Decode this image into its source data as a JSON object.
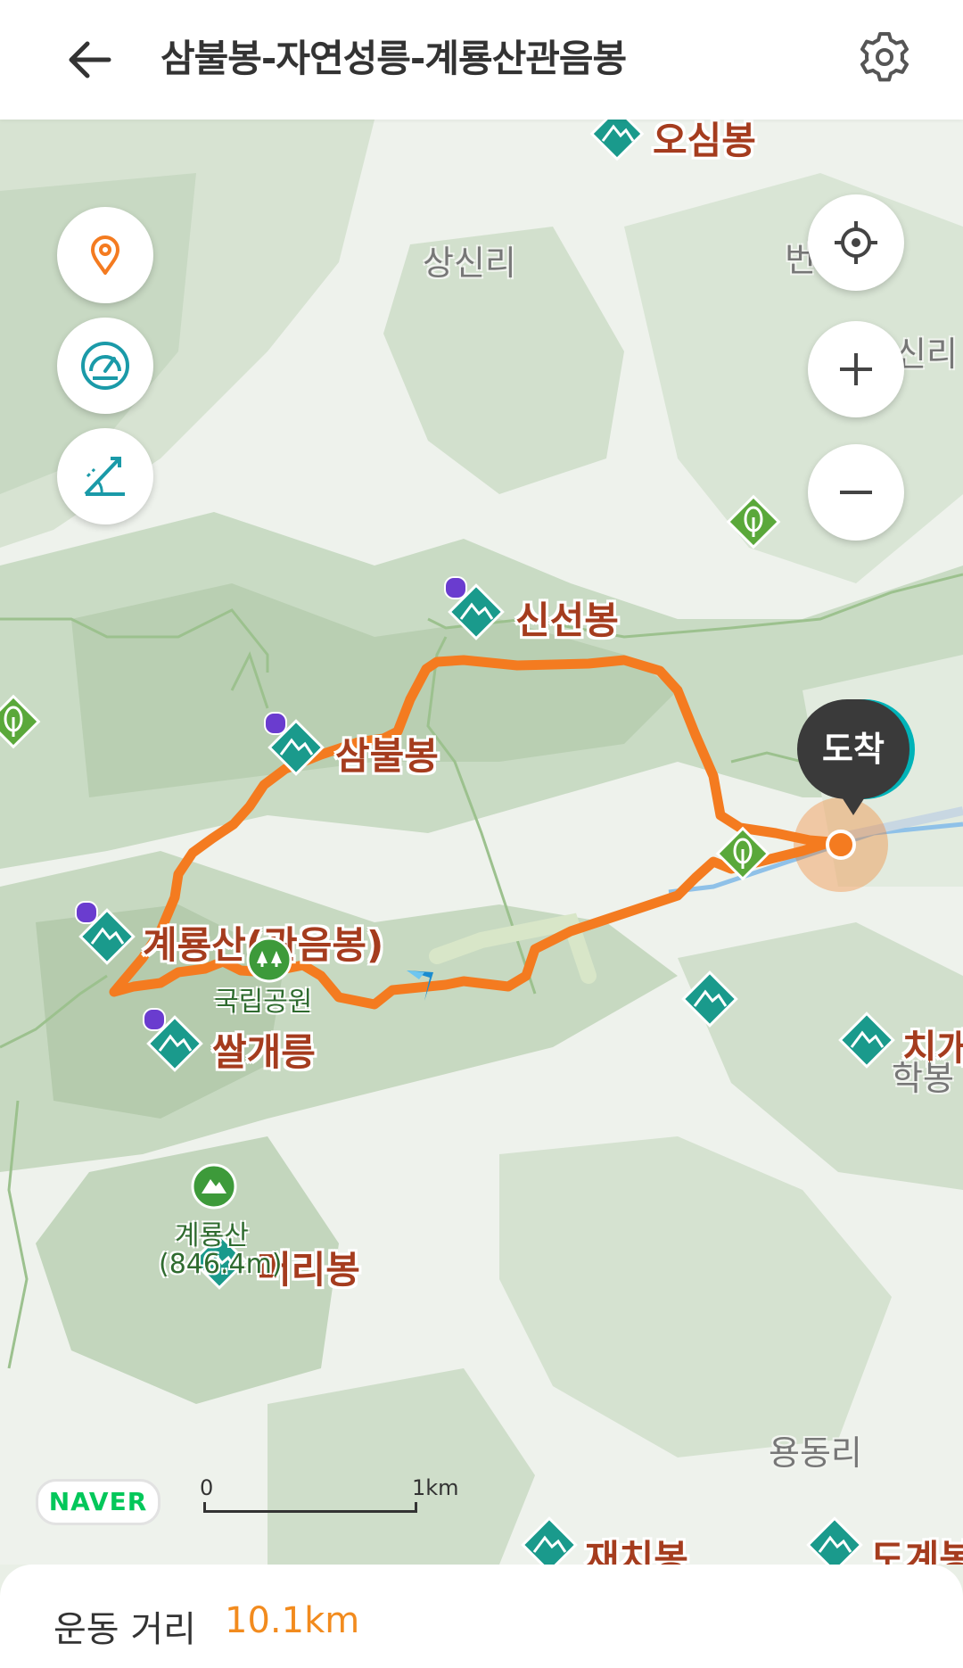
{
  "header": {
    "title": "삼불봉-자연성릉-계룡산관음봉"
  },
  "colors": {
    "route": "#f47b20",
    "peak_icon": "#1a9a8c",
    "peak_label": "#a53c1e",
    "accent": "#f28b1e"
  },
  "map": {
    "villages": [
      "상신리",
      "번",
      "신리",
      "학봉",
      "용동리"
    ],
    "peaks": [
      "오심봉",
      "신선봉",
      "삼불봉",
      "계룡산(관음봉)",
      "쌀개릉",
      "머리봉",
      "치개",
      "재치봉",
      "도계봉"
    ],
    "park_label": "국립공원",
    "summit": {
      "name": "계룡산",
      "elevation": "(846.4m)"
    },
    "destination_label": "도착",
    "brand": "NAVER",
    "scale": {
      "start": "0",
      "end": "1km"
    }
  },
  "controls": {
    "left": [
      "location-pin-icon",
      "speedometer-icon",
      "slope-icon"
    ],
    "right": [
      "crosshair-icon",
      "zoom-in-icon",
      "zoom-out-icon"
    ]
  },
  "summary": {
    "label": "운동 거리",
    "value": "10.1km"
  }
}
